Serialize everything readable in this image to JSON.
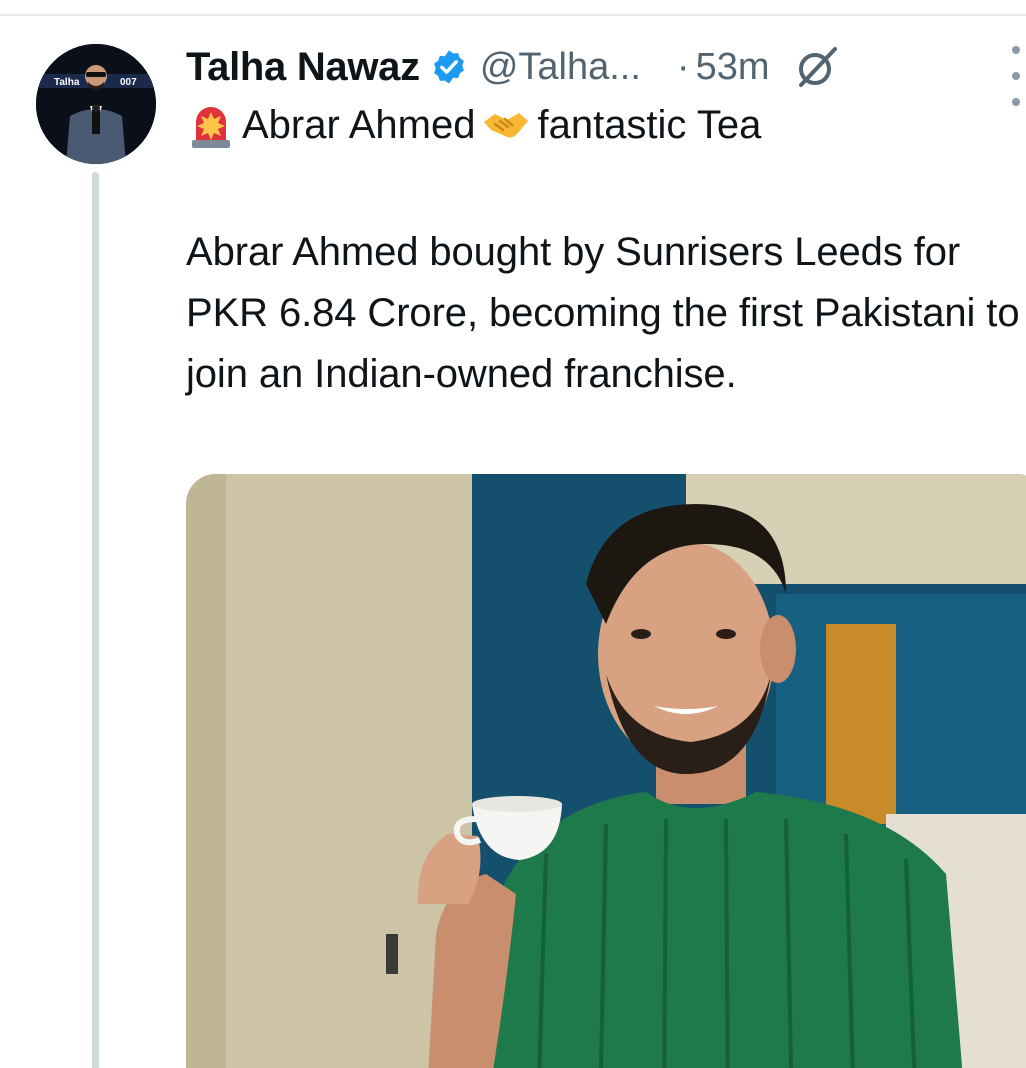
{
  "tweet": {
    "author": {
      "name": "Talha Nawaz",
      "handle": "@Talha...",
      "avatar_caption": "Talha",
      "avatar_tag": "007"
    },
    "separator": "·",
    "time": "53m",
    "headline": {
      "leading_emoji": "police-light-emoji",
      "part1": "Abrar Ahmed",
      "middle_emoji": "handshake-emoji",
      "part2": "fantastic Tea"
    },
    "body": "Abrar Ahmed bought by Sunrisers Leeds for PKR 6.84 Crore, becoming the first Pakistani to join an Indian-owned franchise."
  },
  "icons": {
    "verified": "verified-badge-icon",
    "grok": "grok-icon",
    "more": "more-options-icon"
  },
  "colors": {
    "text_primary": "#0f1419",
    "text_secondary": "#536471",
    "verified_blue": "#1d9bf0",
    "thread_line": "#cfd9de",
    "shirt_green": "#1e7a4b",
    "wall_blue": "#14506e"
  }
}
